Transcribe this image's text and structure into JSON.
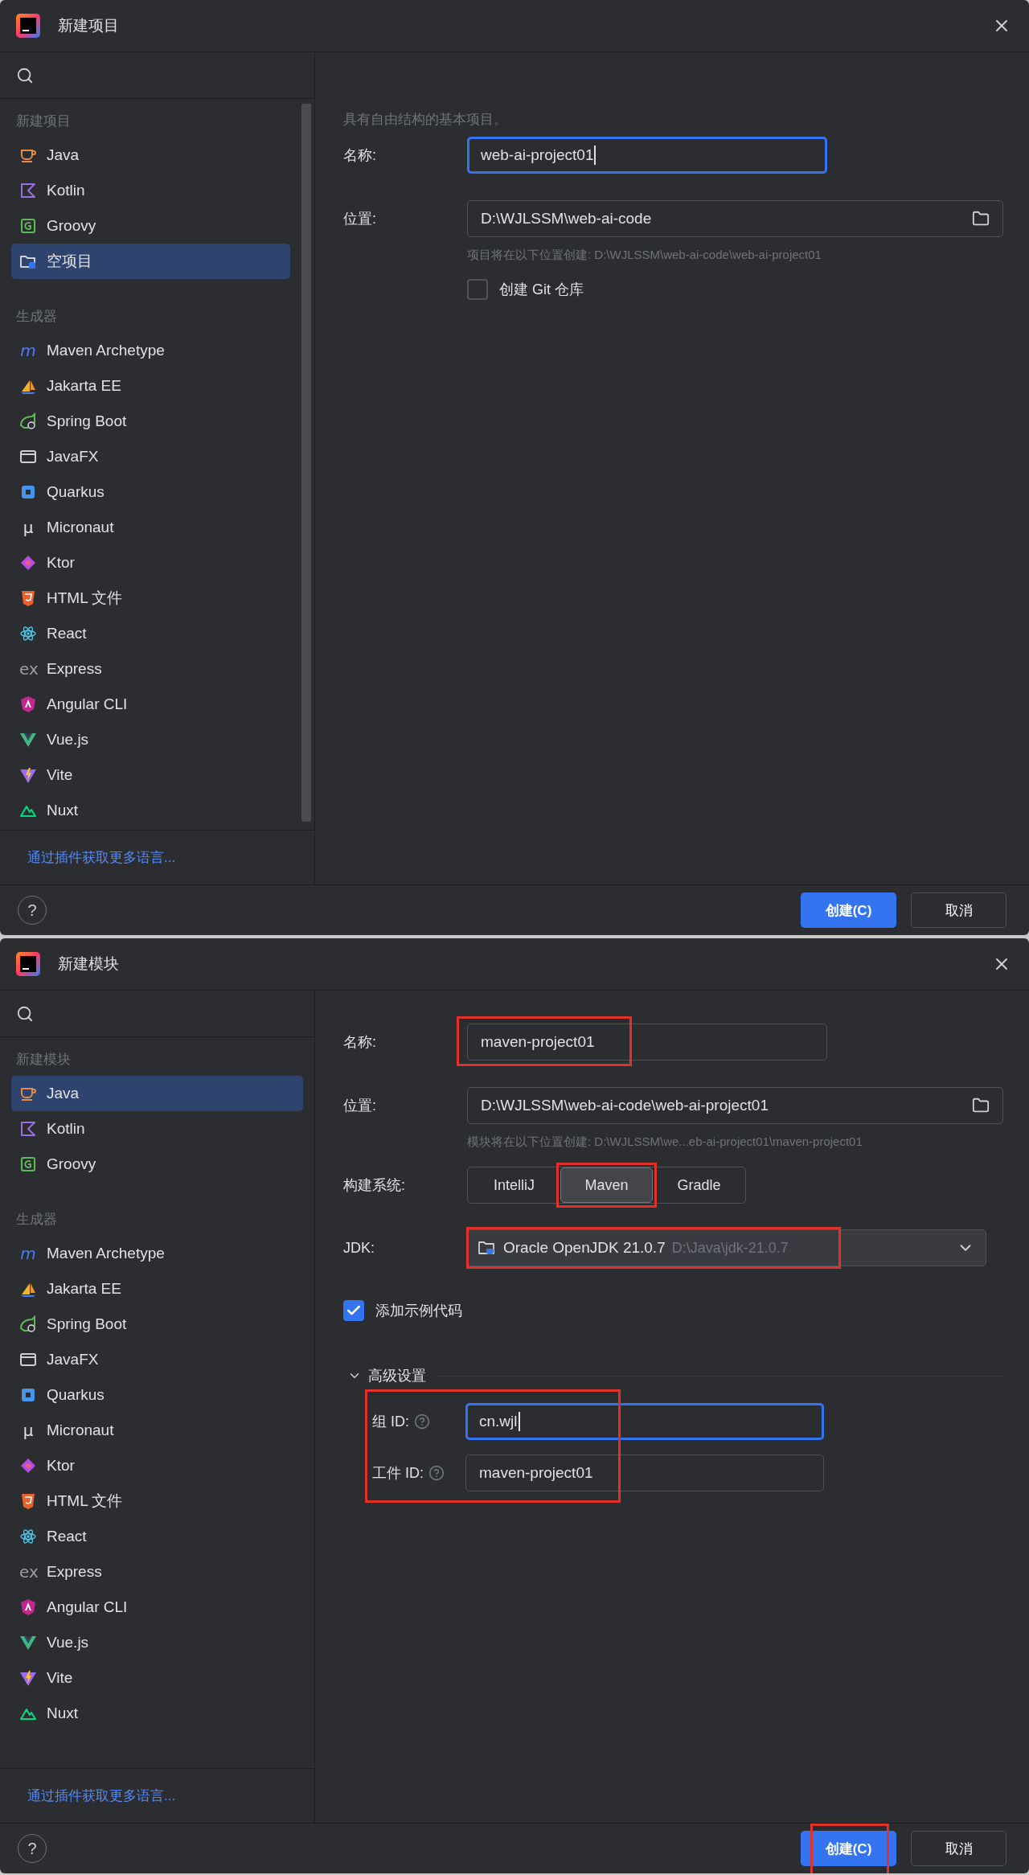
{
  "dialogs": [
    {
      "title": "新建项目",
      "scrollbar": true,
      "sidebar": {
        "groups": [
          {
            "heading": "新建项目",
            "items": [
              {
                "label": "Java",
                "kind": "java",
                "selected": false
              },
              {
                "label": "Kotlin",
                "kind": "kotlin",
                "selected": false
              },
              {
                "label": "Groovy",
                "kind": "groovy",
                "selected": false
              },
              {
                "label": "空项目",
                "kind": "empty",
                "selected": true
              }
            ]
          },
          {
            "heading": "生成器",
            "items": [
              {
                "label": "Maven Archetype",
                "kind": "maven",
                "glyph": "m",
                "selected": false
              },
              {
                "label": "Jakarta EE",
                "kind": "jakarta",
                "selected": false
              },
              {
                "label": "Spring Boot",
                "kind": "spring",
                "selected": false
              },
              {
                "label": "JavaFX",
                "kind": "javafx",
                "selected": false
              },
              {
                "label": "Quarkus",
                "kind": "quarkus",
                "selected": false
              },
              {
                "label": "Micronaut",
                "kind": "micronaut",
                "glyph": "μ",
                "selected": false
              },
              {
                "label": "Ktor",
                "kind": "ktor",
                "selected": false
              },
              {
                "label": "HTML 文件",
                "kind": "html",
                "selected": false
              },
              {
                "label": "React",
                "kind": "react",
                "selected": false
              },
              {
                "label": "Express",
                "kind": "express",
                "glyph": "ex",
                "selected": false
              },
              {
                "label": "Angular CLI",
                "kind": "angular",
                "selected": false
              },
              {
                "label": "Vue.js",
                "kind": "vue",
                "selected": false
              },
              {
                "label": "Vite",
                "kind": "vite",
                "selected": false
              },
              {
                "label": "Nuxt",
                "kind": "nuxt",
                "selected": false
              }
            ]
          }
        ],
        "link": "通过插件获取更多语言..."
      },
      "form": [
        {
          "kind": "description",
          "text": "具有自由结构的基本项目。"
        },
        {
          "kind": "text",
          "label": "名称:",
          "value": "web-ai-project01",
          "focused": true,
          "highlighted": false
        },
        {
          "kind": "path",
          "label": "位置:",
          "value": "D:\\WJLSSM\\web-ai-code"
        },
        {
          "kind": "hint",
          "text": "项目将在以下位置创建: D:\\WJLSSM\\web-ai-code\\web-ai-project01"
        },
        {
          "kind": "checkbox",
          "label": "创建 Git 仓库",
          "checked": false
        }
      ],
      "help": "?",
      "buttons": [
        {
          "label": "创建(C)",
          "primary": true,
          "highlighted": false
        },
        {
          "label": "取消",
          "primary": false,
          "highlighted": false
        }
      ]
    },
    {
      "title": "新建模块",
      "scrollbar": false,
      "sidebar": {
        "groups": [
          {
            "heading": "新建模块",
            "items": [
              {
                "label": "Java",
                "kind": "java",
                "selected": true
              },
              {
                "label": "Kotlin",
                "kind": "kotlin",
                "selected": false
              },
              {
                "label": "Groovy",
                "kind": "groovy",
                "selected": false
              }
            ]
          },
          {
            "heading": "生成器",
            "items": [
              {
                "label": "Maven Archetype",
                "kind": "maven",
                "glyph": "m",
                "selected": false
              },
              {
                "label": "Jakarta EE",
                "kind": "jakarta",
                "selected": false
              },
              {
                "label": "Spring Boot",
                "kind": "spring",
                "selected": false
              },
              {
                "label": "JavaFX",
                "kind": "javafx",
                "selected": false
              },
              {
                "label": "Quarkus",
                "kind": "quarkus",
                "selected": false
              },
              {
                "label": "Micronaut",
                "kind": "micronaut",
                "glyph": "μ",
                "selected": false
              },
              {
                "label": "Ktor",
                "kind": "ktor",
                "selected": false
              },
              {
                "label": "HTML 文件",
                "kind": "html",
                "selected": false
              },
              {
                "label": "React",
                "kind": "react",
                "selected": false
              },
              {
                "label": "Express",
                "kind": "express",
                "glyph": "ex",
                "selected": false
              },
              {
                "label": "Angular CLI",
                "kind": "angular",
                "selected": false
              },
              {
                "label": "Vue.js",
                "kind": "vue",
                "selected": false
              },
              {
                "label": "Vite",
                "kind": "vite",
                "selected": false
              },
              {
                "label": "Nuxt",
                "kind": "nuxt",
                "selected": false
              }
            ]
          }
        ],
        "link": "通过插件获取更多语言..."
      },
      "form": [
        {
          "kind": "text",
          "label": "名称:",
          "value": "maven-project01",
          "focused": false,
          "highlighted": true
        },
        {
          "kind": "path",
          "label": "位置:",
          "value": "D:\\WJLSSM\\web-ai-code\\web-ai-project01"
        },
        {
          "kind": "hint",
          "text": "模块将在以下位置创建: D:\\WJLSSM\\we...eb-ai-project01\\maven-project01"
        },
        {
          "kind": "segmented",
          "label": "构建系统:",
          "options": [
            {
              "label": "IntelliJ",
              "selected": false,
              "highlighted": false
            },
            {
              "label": "Maven",
              "selected": true,
              "highlighted": true
            },
            {
              "label": "Gradle",
              "selected": false,
              "highlighted": false
            }
          ]
        },
        {
          "kind": "dropdown",
          "label": "JDK:",
          "value": "Oracle OpenJDK 21.0.7",
          "detail": "D:\\Java\\jdk-21.0.7",
          "highlighted": true
        },
        {
          "kind": "checkbox",
          "label": "添加示例代码",
          "checked": true
        },
        {
          "kind": "section",
          "label": "高级设置",
          "expanded": true,
          "highlighted": true,
          "fields": [
            {
              "label": "组 ID:",
              "value": "cn.wjl",
              "focused": true
            },
            {
              "label": "工件 ID:",
              "value": "maven-project01",
              "focused": false
            }
          ]
        }
      ],
      "help": "?",
      "buttons": [
        {
          "label": "创建(C)",
          "primary": true,
          "highlighted": true
        },
        {
          "label": "取消",
          "primary": false,
          "highlighted": false
        }
      ]
    }
  ]
}
